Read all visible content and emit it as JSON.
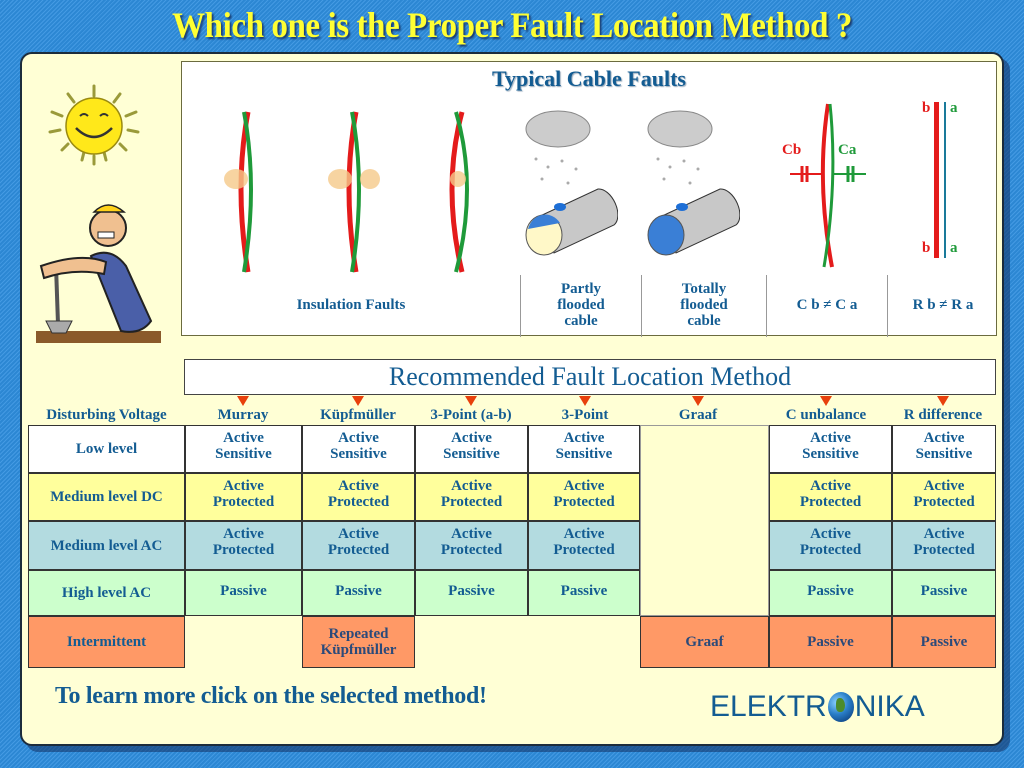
{
  "title": "Which one is the Proper Fault Location Method ?",
  "typical_faults": {
    "title": "Typical Cable Faults",
    "labels": {
      "insulation": "Insulation Faults",
      "partly_flooded": [
        "Partly",
        "flooded",
        "cable"
      ],
      "totally_flooded": [
        "Totally",
        "flooded",
        "cable"
      ],
      "c_unbalance": "C b ≠ C a",
      "r_difference": "R b ≠ R a"
    },
    "capacitor_labels": {
      "cb": "Cb",
      "ca": "Ca"
    },
    "wire_labels": {
      "b": "b",
      "a": "a"
    }
  },
  "recommended": {
    "title": "Recommended Fault Location Method",
    "row_header_label": "Disturbing Voltage",
    "methods": [
      "Murray",
      "Küpfmüller",
      "3-Point (a-b)",
      "3-Point",
      "Graaf",
      "C unbalance",
      "R difference"
    ],
    "rows": [
      {
        "label": "Low level",
        "cells": [
          [
            "Active",
            "Sensitive"
          ],
          [
            "Active",
            "Sensitive"
          ],
          [
            "Active",
            "Sensitive"
          ],
          [
            "Active",
            "Sensitive"
          ],
          [],
          [
            "Active",
            "Sensitive"
          ],
          [
            "Active",
            "Sensitive"
          ]
        ]
      },
      {
        "label": "Medium level  DC",
        "cells": [
          [
            "Active",
            "Protected"
          ],
          [
            "Active",
            "Protected"
          ],
          [
            "Active",
            "Protected"
          ],
          [
            "Active",
            "Protected"
          ],
          [],
          [
            "Active",
            "Protected"
          ],
          [
            "Active",
            "Protected"
          ]
        ]
      },
      {
        "label": "Medium level  AC",
        "cells": [
          [
            "Active",
            "Protected"
          ],
          [
            "Active",
            "Protected"
          ],
          [
            "Active",
            "Protected"
          ],
          [
            "Active",
            "Protected"
          ],
          [],
          [
            "Active",
            "Protected"
          ],
          [
            "Active",
            "Protected"
          ]
        ]
      },
      {
        "label": "High level  AC",
        "cells": [
          [
            "Passive"
          ],
          [
            "Passive"
          ],
          [
            "Passive"
          ],
          [
            "Passive"
          ],
          [],
          [
            "Passive"
          ],
          [
            "Passive"
          ]
        ]
      },
      {
        "label": "Intermittent",
        "cells": [
          [],
          [
            "Repeated",
            "Küpfmüller"
          ],
          [],
          [],
          [
            "Graaf"
          ],
          [
            "Passive"
          ],
          [
            "Passive"
          ]
        ]
      }
    ]
  },
  "footer": {
    "hint": "To learn more click on the selected method!",
    "logo_left": "ELEKTR",
    "logo_right": "NIKA"
  },
  "colors": {
    "title": "#ffff33",
    "text_blue": "#135c92",
    "arrow": "#e8400c",
    "row_low": "#ffffff",
    "row_medium_dc": "#ffff9c",
    "row_medium_ac": "#b3dbe0",
    "row_high_ac": "#ccffcc",
    "row_intermittent": "#ff9966"
  }
}
